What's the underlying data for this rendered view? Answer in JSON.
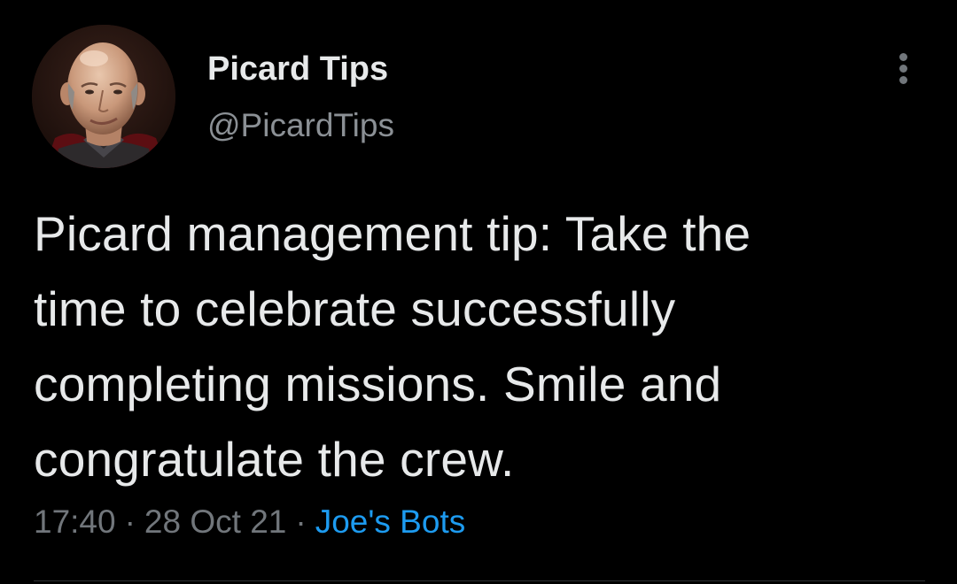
{
  "author": {
    "display_name": "Picard Tips",
    "handle": "@PicardTips",
    "avatar_icon": "profile-photo"
  },
  "more_icon": "more-vertical-icon",
  "tweet": {
    "lines": [
      "Picard management tip: Take the",
      "time to celebrate successfully",
      "completing missions. Smile and",
      "congratulate the crew."
    ]
  },
  "meta": {
    "time": "17:40",
    "separator": "·",
    "date": "28 Oct 21",
    "source": "Joe's Bots"
  },
  "colors": {
    "background": "#000000",
    "text": "#e7e9ea",
    "secondary_text": "#71767b",
    "link": "#1d9bf0"
  }
}
